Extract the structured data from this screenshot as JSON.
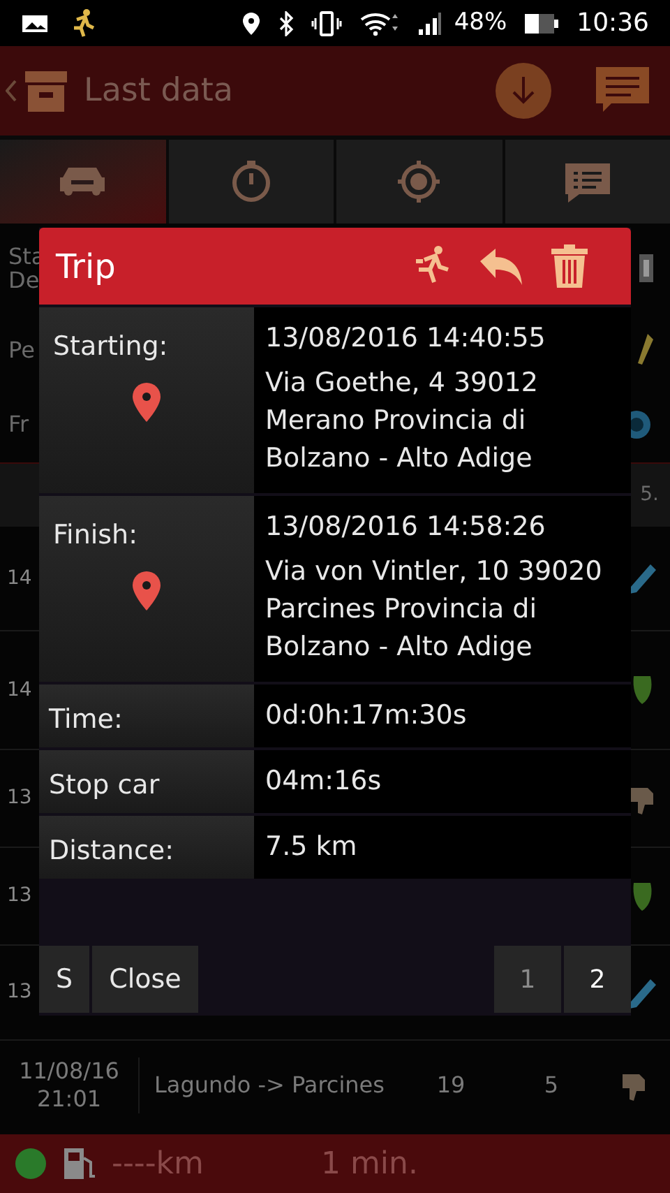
{
  "status_bar": {
    "battery": "48%",
    "time": "10:36"
  },
  "header": {
    "title": "Last data"
  },
  "tabs": [
    {
      "selected": true
    },
    {
      "selected": false
    },
    {
      "selected": false
    },
    {
      "selected": false
    }
  ],
  "background": {
    "info": [
      {
        "lines": [
          "Sta",
          "De"
        ]
      },
      {
        "lines": [
          "Pe"
        ]
      },
      {
        "lines": [
          "Fr"
        ]
      }
    ],
    "table_header": "5.",
    "rows": [
      {
        "column_1": "14"
      },
      {
        "column_1": "14"
      },
      {
        "column_1": "13"
      },
      {
        "column_1": "13"
      },
      {
        "column_1": "13"
      }
    ],
    "last_row": {
      "date": "11/08/16",
      "time": "21:01",
      "route": "Lagundo -> Parcines",
      "column_3": "19",
      "column_4": "5"
    }
  },
  "dialog": {
    "title": "Trip",
    "rows": [
      {
        "kind": "place",
        "label": "Starting:",
        "datetime": "13/08/2016 14:40:55",
        "address": "Via Goethe, 4 39012 Merano Provincia di Bolzano - Alto Adige"
      },
      {
        "kind": "place",
        "label": "Finish:",
        "datetime": "13/08/2016 14:58:26",
        "address": "Via von Vintler, 10 39020 Parcines Provincia di Bolzano - Alto Adige"
      },
      {
        "kind": "value",
        "label": "Time:",
        "value": "0d:0h:17m:30s"
      },
      {
        "kind": "value",
        "label": "Stop car",
        "value": "04m:16s"
      },
      {
        "kind": "value",
        "label": "Distance:",
        "value": "7.5 km"
      }
    ],
    "left_buttons": [
      "S",
      "Close"
    ],
    "pages": [
      {
        "label": "1",
        "selected": false
      },
      {
        "label": "2",
        "selected": true
      }
    ]
  },
  "footer": {
    "distance": "----km",
    "time": "1 min."
  }
}
